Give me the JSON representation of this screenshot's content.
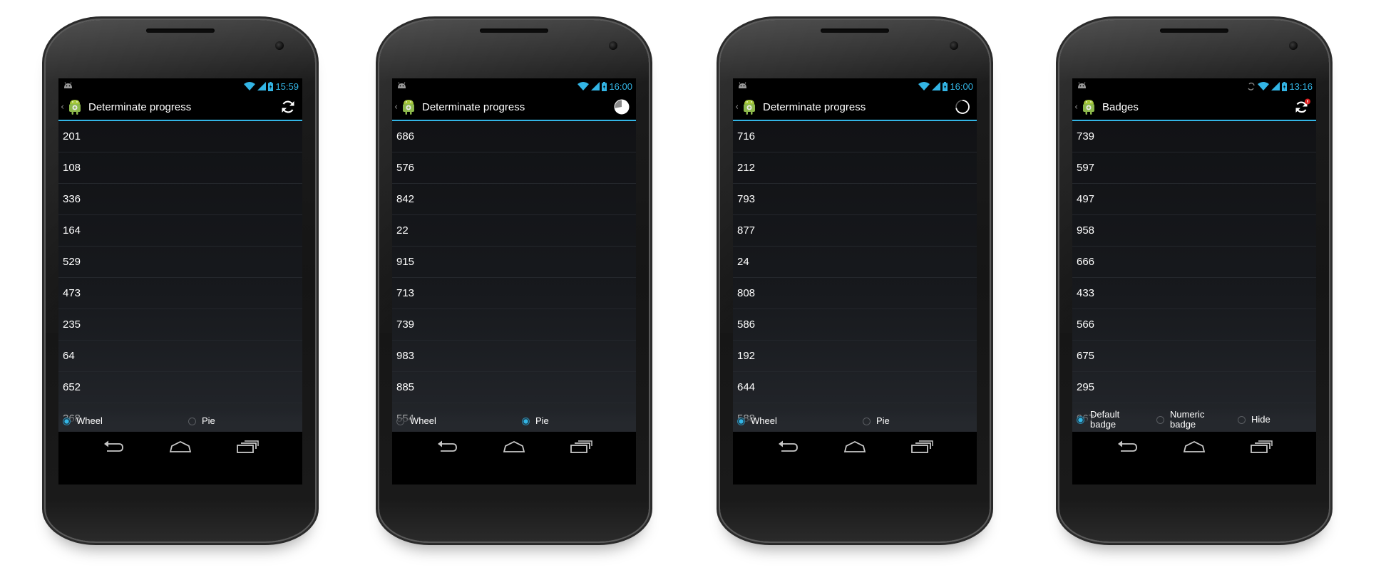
{
  "colors": {
    "accent": "#33b5e5",
    "badge": "#e02020",
    "list_text": "#ffffff",
    "background": "#ffffff"
  },
  "phones": [
    {
      "status_time": "15:59",
      "title": "Determinate progress",
      "action_icon": "refresh-icon",
      "items": [
        "201",
        "108",
        "336",
        "164",
        "529",
        "473",
        "235",
        "64",
        "652",
        "368"
      ],
      "options": [
        {
          "label": "Wheel",
          "selected": true
        },
        {
          "label": "Pie",
          "selected": false
        }
      ]
    },
    {
      "status_time": "16:00",
      "title": "Determinate progress",
      "action_icon": "pie-progress-icon",
      "pie_progress": 0.72,
      "items": [
        "686",
        "576",
        "842",
        "22",
        "915",
        "713",
        "739",
        "983",
        "885",
        "554"
      ],
      "options": [
        {
          "label": "Wheel",
          "selected": false
        },
        {
          "label": "Pie",
          "selected": true
        }
      ]
    },
    {
      "status_time": "16:00",
      "title": "Determinate progress",
      "action_icon": "wheel-progress-icon",
      "wheel_progress": 0.72,
      "items": [
        "716",
        "212",
        "793",
        "877",
        "24",
        "808",
        "586",
        "192",
        "644",
        "588"
      ],
      "options": [
        {
          "label": "Wheel",
          "selected": true
        },
        {
          "label": "Pie",
          "selected": false
        }
      ]
    },
    {
      "status_time": "13:16",
      "title": "Badges",
      "action_icon": "refresh-badge-icon",
      "items": [
        "739",
        "597",
        "497",
        "958",
        "666",
        "433",
        "566",
        "675",
        "295",
        "967"
      ],
      "options": [
        {
          "label": "Default badge",
          "line1": "Default",
          "line2": "badge",
          "selected": true
        },
        {
          "label": "Numeric badge",
          "line1": "Numeric",
          "line2": "badge",
          "selected": false
        },
        {
          "label": "Hide",
          "line1": "Hide",
          "line2": "",
          "selected": false
        }
      ]
    }
  ]
}
